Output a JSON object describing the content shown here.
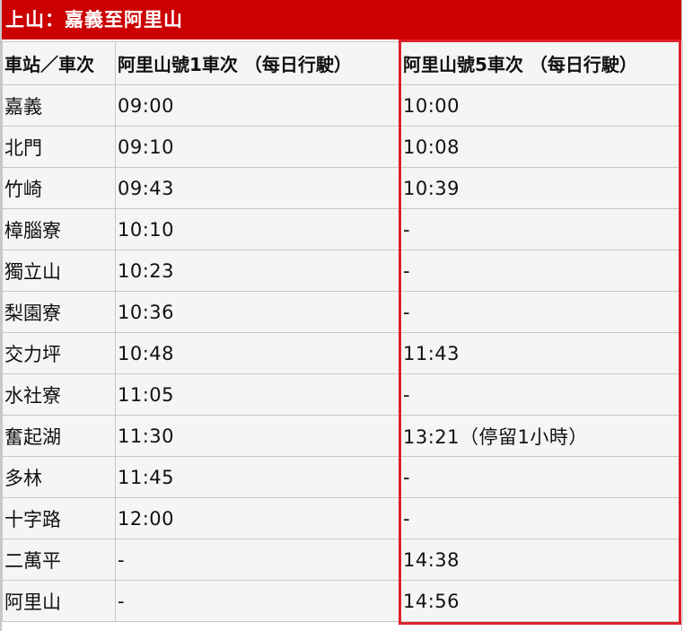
{
  "title": "上山：嘉義至阿里山",
  "headers": [
    "車站／車次",
    "阿里山號1車次 （每日行駛）",
    "阿里山號5車次 （每日行駛）"
  ],
  "rows": [
    {
      "station": "嘉義",
      "train1": "09:00",
      "train5": "10:00"
    },
    {
      "station": "北門",
      "train1": "09:10",
      "train5": "10:08"
    },
    {
      "station": "竹崎",
      "train1": "09:43",
      "train5": "10:39"
    },
    {
      "station": "樟腦寮",
      "train1": "10:10",
      "train5": "-"
    },
    {
      "station": "獨立山",
      "train1": "10:23",
      "train5": "-"
    },
    {
      "station": "梨園寮",
      "train1": "10:36",
      "train5": "-"
    },
    {
      "station": "交力坪",
      "train1": "10:48",
      "train5": "11:43"
    },
    {
      "station": "水社寮",
      "train1": "11:05",
      "train5": "-"
    },
    {
      "station": "奮起湖",
      "train1": "11:30",
      "train5": "13:21（停留1小時）"
    },
    {
      "station": "多林",
      "train1": "11:45",
      "train5": "-"
    },
    {
      "station": "十字路",
      "train1": "12:00",
      "train5": "-"
    },
    {
      "station": "二萬平",
      "train1": "-",
      "train5": "14:38"
    },
    {
      "station": "阿里山",
      "train1": "-",
      "train5": "14:56"
    }
  ],
  "colors": {
    "title_background": "#cc0000",
    "highlight_border": "#e0202c",
    "cell_background": "#f5f5f5",
    "grid_line": "#c8c8c8"
  }
}
